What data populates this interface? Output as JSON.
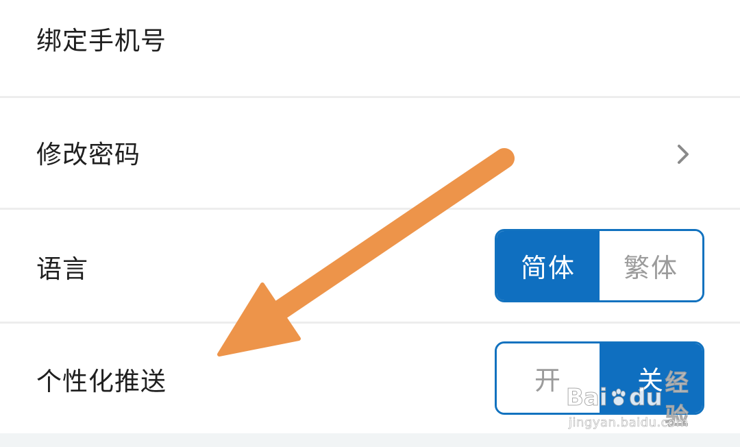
{
  "settings": {
    "bind_phone_label": "绑定手机号",
    "change_password_label": "修改密码",
    "language": {
      "label": "语言",
      "options": [
        "简体",
        "繁体"
      ],
      "selected": "简体"
    },
    "personalized_push": {
      "label": "个性化推送",
      "options": [
        "开",
        "关"
      ],
      "selected": "关"
    }
  },
  "annotation": {
    "arrow_color": "#ED944A"
  },
  "watermark": {
    "logo_text_left": "Bai",
    "logo_text_right": "du",
    "logo_suffix": "经验",
    "url": "jingyan.baidu.com"
  },
  "colors": {
    "accent": "#0F6FC0",
    "divider": "#EDEDED",
    "inactive_text": "#9B9B9B"
  }
}
